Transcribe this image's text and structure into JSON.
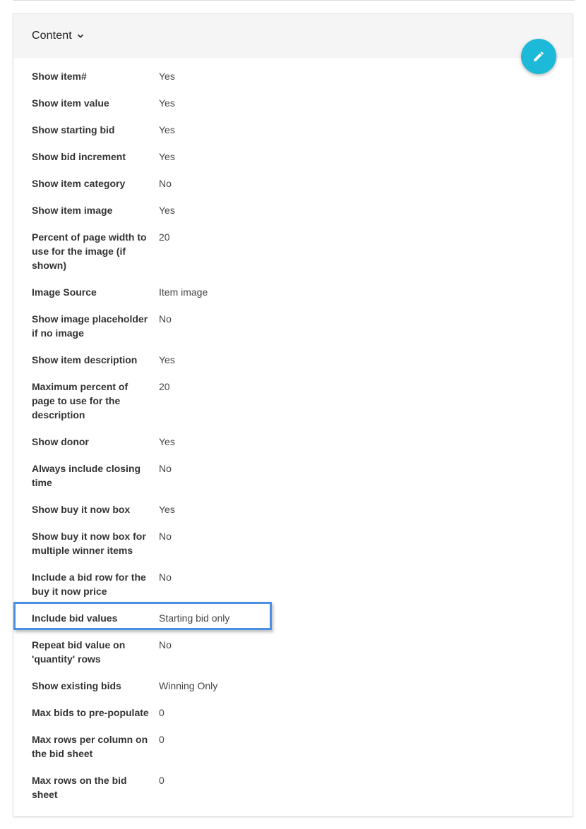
{
  "section": {
    "title": "Content",
    "edit_icon": "pencil-icon",
    "toggle_icon": "chevron-down-icon",
    "accent_color": "#1cbad8",
    "highlight_color": "#4a90e2"
  },
  "settings": [
    {
      "label": "Show item#",
      "value": "Yes"
    },
    {
      "label": "Show item value",
      "value": "Yes"
    },
    {
      "label": "Show starting bid",
      "value": "Yes"
    },
    {
      "label": "Show bid increment",
      "value": "Yes"
    },
    {
      "label": "Show item category",
      "value": "No"
    },
    {
      "label": "Show item image",
      "value": "Yes"
    },
    {
      "label": "Percent of page width to use for the image (if shown)",
      "value": "20"
    },
    {
      "label": "Image Source",
      "value": "Item image"
    },
    {
      "label": "Show image placeholder if no image",
      "value": "No"
    },
    {
      "label": "Show item description",
      "value": "Yes"
    },
    {
      "label": "Maximum percent of page to use for the description",
      "value": "20"
    },
    {
      "label": "Show donor",
      "value": "Yes"
    },
    {
      "label": "Always include closing time",
      "value": "No"
    },
    {
      "label": "Show buy it now box",
      "value": "Yes"
    },
    {
      "label": "Show buy it now box for multiple winner items",
      "value": "No"
    },
    {
      "label": "Include a bid row for the buy it now price",
      "value": "No"
    },
    {
      "label": "Include bid values",
      "value": "Starting bid only"
    },
    {
      "label": "Repeat bid value on 'quantity' rows",
      "value": "No"
    },
    {
      "label": "Show existing bids",
      "value": "Winning Only"
    },
    {
      "label": "Max bids to pre-populate",
      "value": "0"
    },
    {
      "label": "Max rows per column on the bid sheet",
      "value": "0"
    },
    {
      "label": "Max rows on the bid sheet",
      "value": "0"
    }
  ]
}
